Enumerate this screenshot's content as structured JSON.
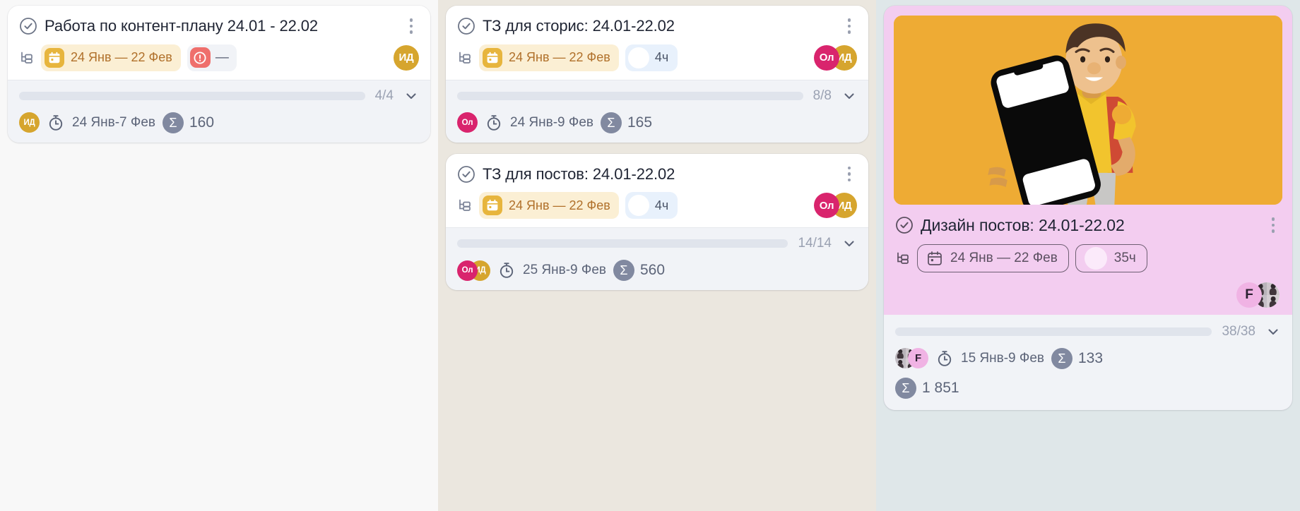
{
  "board": {
    "columns": [
      {
        "name": "column-left",
        "bg": "#f8f8f8",
        "cards": [
          {
            "id": "card-content-plan",
            "title": "Работа по контент-плану 24.01 - 22.02",
            "date_pill": "24 Янв — 22 Фев",
            "priority_label": "—",
            "assignees": [
              {
                "initials": "ИД",
                "style": "gold"
              }
            ],
            "progress_count": "4/4",
            "progress_pct": 100,
            "footer_assignees": [
              {
                "initials": "ИД",
                "style": "gold"
              }
            ],
            "time_range": "24 Янв-7 Фев",
            "sum_symbol": "Σ",
            "sum_value": "160"
          }
        ]
      },
      {
        "name": "column-middle",
        "bg": "#ebe7df",
        "cards": [
          {
            "id": "card-tz-storis",
            "title": "ТЗ для сторис: 24.01-22.02",
            "date_pill": "24 Янв — 22 Фев",
            "hours_pill": "4ч",
            "assignees": [
              {
                "initials": "Ол",
                "style": "pink"
              },
              {
                "initials": "ИД",
                "style": "gold"
              }
            ],
            "progress_count": "8/8",
            "progress_pct": 100,
            "footer_assignees": [
              {
                "initials": "Ол",
                "style": "pink"
              }
            ],
            "time_range": "24 Янв-9 Фев",
            "sum_symbol": "Σ",
            "sum_value": "165"
          },
          {
            "id": "card-tz-posts",
            "title": "ТЗ для постов: 24.01-22.02",
            "date_pill": "24 Янв — 22 Фев",
            "hours_pill": "4ч",
            "assignees": [
              {
                "initials": "Ол",
                "style": "pink"
              },
              {
                "initials": "ИД",
                "style": "gold"
              }
            ],
            "progress_count": "14/14",
            "progress_pct": 100,
            "footer_assignees": [
              {
                "initials": "Ол",
                "style": "pink"
              },
              {
                "initials": "ИД",
                "style": "gold"
              }
            ],
            "time_range": "25 Янв-9 Фев",
            "sum_symbol": "Σ",
            "sum_value": "560"
          }
        ]
      },
      {
        "name": "column-right",
        "bg": "#dfe7e9",
        "cards": [
          {
            "id": "card-design-posts",
            "title": "Дизайн постов: 24.01-22.02",
            "cover_alt": "3d-character-holding-phone-illustration",
            "cover_bg": "#eeab34",
            "card_bg": "#f3cdf0",
            "date_pill": "24 Янв — 22 Фев",
            "hours_pill": "35ч",
            "assignees": [
              {
                "initials": "F",
                "style": "f-pink"
              },
              {
                "initials": "",
                "style": "photo"
              }
            ],
            "progress_count": "38/38",
            "progress_pct": 100,
            "footer_assignees": [
              {
                "initials": "",
                "style": "photo"
              },
              {
                "initials": "F",
                "style": "f-pink"
              }
            ],
            "time_range": "15 Янв-9 Фев",
            "sum_symbol": "Σ",
            "sum_value": "133",
            "total_symbol": "Σ",
            "total_value": "1 851"
          }
        ]
      }
    ]
  },
  "icons": {
    "check": "check-circle-icon",
    "kebab": "more-vertical-icon",
    "subtask": "subtask-tree-icon",
    "calendar": "calendar-icon",
    "priority": "priority-alert-icon",
    "chevron": "chevron-down-icon",
    "timer": "stopwatch-icon",
    "sum": "sum-sigma-icon"
  },
  "colors": {
    "progress_green": "#84c361",
    "accent_gold": "#d6a52e",
    "accent_pink": "#d9246d",
    "priority_red": "#ef6f6c",
    "purple_card": "#f3cdf0",
    "cover_orange": "#eeab34"
  }
}
